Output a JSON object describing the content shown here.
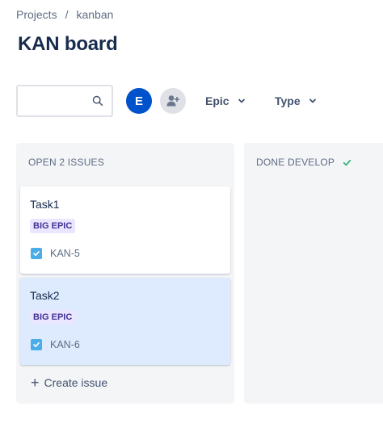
{
  "breadcrumb": {
    "items": [
      "Projects",
      "kanban"
    ],
    "separator": "/"
  },
  "page": {
    "title": "KAN board"
  },
  "search": {
    "value": "",
    "placeholder": "",
    "icon": "search-icon"
  },
  "people": {
    "avatar_initial": "E",
    "avatar_color": "#0052cc",
    "add_icon": "add-person-icon"
  },
  "filters": {
    "epic_label": "Epic",
    "type_label": "Type"
  },
  "columns": [
    {
      "header": "OPEN 2 ISSUES",
      "cards": [
        {
          "title": "Task1",
          "epic": "BIG EPIC",
          "key": "KAN-5",
          "selected": false
        },
        {
          "title": "Task2",
          "epic": "BIG EPIC",
          "key": "KAN-6",
          "selected": true
        }
      ],
      "create_label": "Create issue"
    },
    {
      "header": "DONE DEVELOP",
      "done_icon": "check-icon"
    }
  ],
  "colors": {
    "accent": "#0052cc",
    "epic_bg": "#eae6ff",
    "epic_text": "#403294",
    "task_icon": "#4bade8",
    "done_check": "#36b37e",
    "selected_card": "#deebff"
  }
}
